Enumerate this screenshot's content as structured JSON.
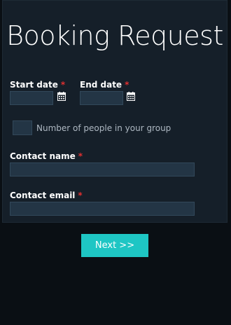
{
  "form": {
    "title": "Booking Request",
    "start_date": {
      "label": "Start date",
      "required_mark": "*",
      "value": ""
    },
    "end_date": {
      "label": "End date",
      "required_mark": "*",
      "value": ""
    },
    "group_checkbox": {
      "label": "Number of people in your group",
      "checked": false
    },
    "contact_name": {
      "label": "Contact name",
      "required_mark": "*",
      "value": ""
    },
    "contact_email": {
      "label": "Contact email",
      "required_mark": "*",
      "value": ""
    },
    "next_label": "Next >>"
  },
  "icons": {
    "calendar": "calendar-icon"
  },
  "colors": {
    "background": "#0a0f14",
    "card": "#151f29",
    "input": "#233545",
    "required": "#e03030",
    "accent": "#1ec6c4"
  }
}
